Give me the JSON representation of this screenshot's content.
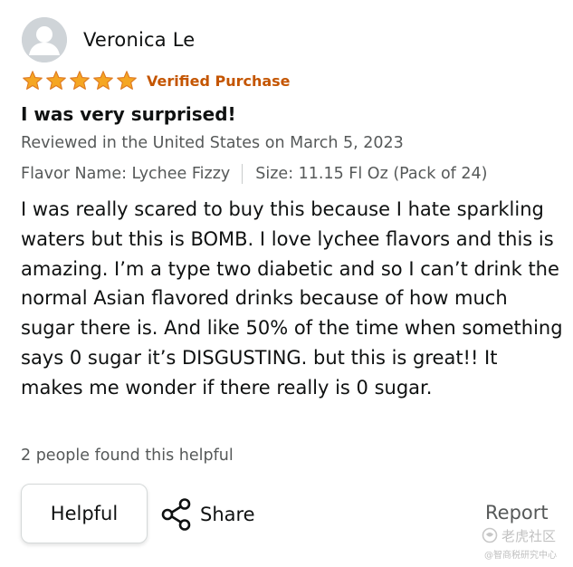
{
  "reviewer": {
    "name": "Veronica Le",
    "avatar_icon": "user-silhouette-icon"
  },
  "rating": {
    "stars": 5,
    "max_stars": 5,
    "star_color": "#f5a623",
    "verified_label": "Verified Purchase",
    "verified_color": "#c45500"
  },
  "review": {
    "title": "I was very surprised!",
    "date_line": "Reviewed in the United States on March 5, 2023",
    "flavor": "Flavor Name: Lychee Fizzy",
    "size": "Size: 11.15 Fl Oz (Pack of 24)",
    "body": "I was really scared to buy this because I hate sparkling waters but this is BOMB. I love lychee flavors and this is amazing. I’m a type two diabetic and so I can’t drink the normal Asian flavored drinks because of how much sugar there is. And like 50% of the time when something says 0 sugar it’s DISGUSTING. but this is great!! It makes me wonder if there really is 0 sugar."
  },
  "helpfulness": {
    "count_text": "2 people found this helpful"
  },
  "actions": {
    "helpful_label": "Helpful",
    "share_label": "Share",
    "share_icon": "share-icon",
    "report_label": "Report"
  },
  "watermark": {
    "text": "老虎社区",
    "sub_text": "@智商税研究中心"
  }
}
